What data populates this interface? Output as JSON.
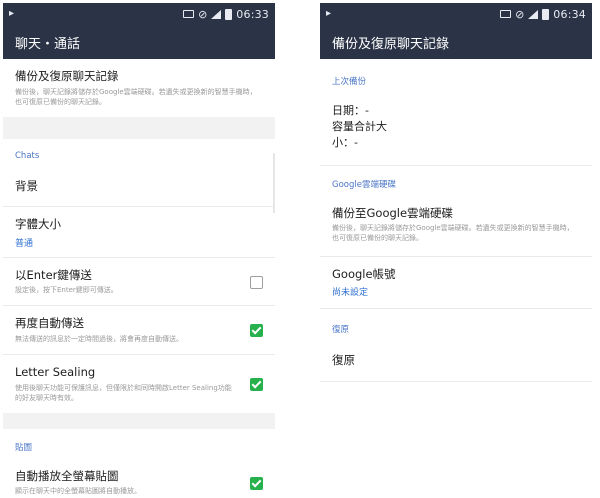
{
  "left": {
    "status": {
      "time": "06:33"
    },
    "title": "聊天・通話",
    "backup": {
      "title": "備份及復原聊天記錄",
      "desc": "備份後，聊天記錄將儲存於Google雲端硬碟。若遺失或更換新的智慧手機時，也可復原已備份的聊天記錄。"
    },
    "section_chats": "Chats",
    "background": "背景",
    "font_size": {
      "title": "字體大小",
      "value": "普通"
    },
    "enter_send": {
      "title": "以Enter鍵傳送",
      "desc": "設定後，按下Enter鍵即可傳送。",
      "checked": false
    },
    "auto_resend": {
      "title": "再度自動傳送",
      "desc": "無法傳送的訊息於一定時間過後，將會再度自動傳送。",
      "checked": true
    },
    "letter_sealing": {
      "title": "Letter Sealing",
      "desc": "使用後聊天功能可保護訊息，但僅限於和同時開啟Letter Sealing功能的好友聊天時有效。",
      "checked": true
    },
    "section_stickers": "貼圖",
    "autoplay": {
      "title": "自動播放全螢幕貼圖",
      "desc": "顯示在聊天中的全螢幕貼圖將自動播放。",
      "checked": true
    }
  },
  "right": {
    "status": {
      "time": "06:34"
    },
    "title": "備份及復原聊天記錄",
    "section_last": "上次備份",
    "date_label": "日期：-",
    "size_label_1": "容量合計大",
    "size_label_2": "小：-",
    "section_gdrive": "Google雲端硬碟",
    "backup_gdrive": {
      "title": "備份至Google雲端硬碟",
      "desc": "備份後，聊天記錄將儲存於Google雲端硬碟。若遺失或更換新的智慧手機時，也可復原已備份的聊天記錄。"
    },
    "account": {
      "title": "Google帳號",
      "value": "尚未設定"
    },
    "section_restore": "復原",
    "restore": "復原"
  },
  "icons": [
    "cast-icon",
    "mute-icon",
    "signal-icon",
    "battery-icon",
    "checkbox-icon"
  ],
  "colors": {
    "bar": "#2b3346",
    "accent_blue": "#2f6fd2",
    "check_green": "#26b14d"
  }
}
